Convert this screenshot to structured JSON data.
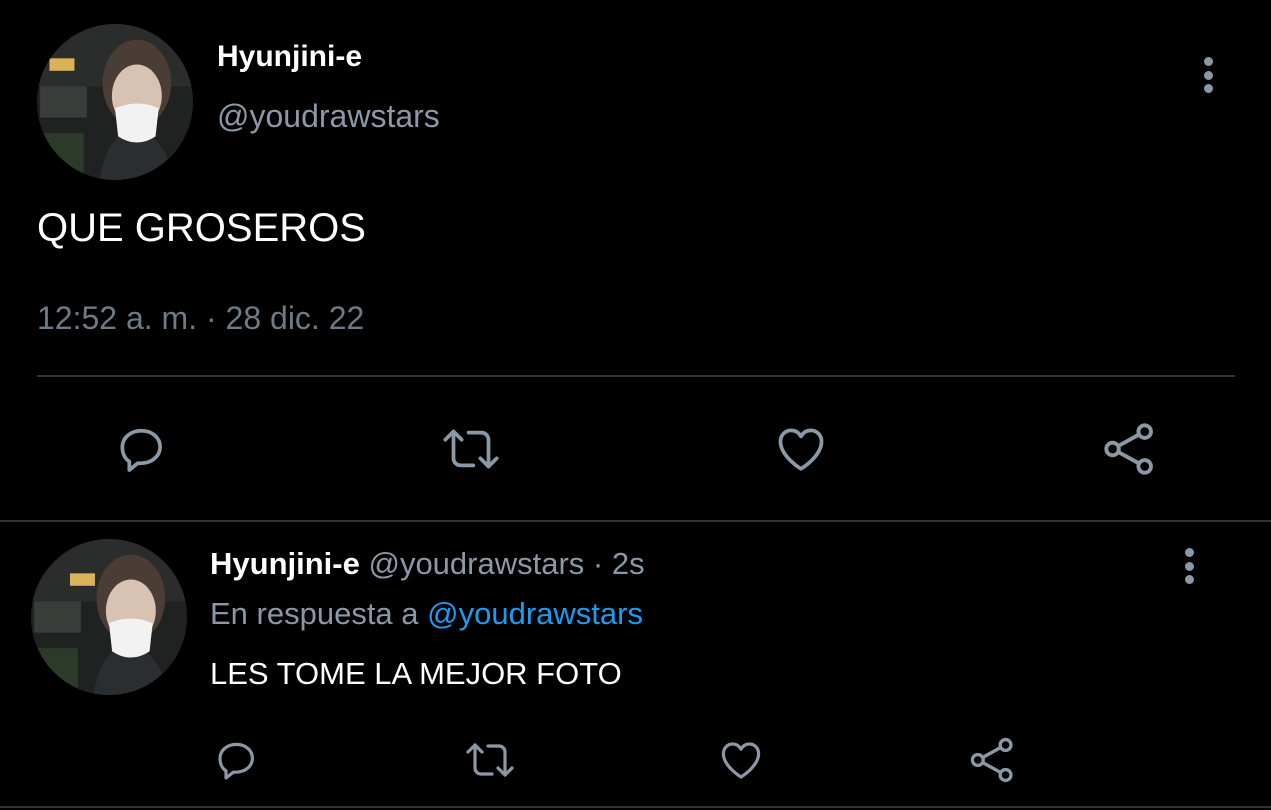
{
  "main_tweet": {
    "display_name": "Hyunjini-e",
    "handle": "@youdrawstars",
    "text": "QUE GROSEROS",
    "time": "12:52 a. m.",
    "separator": " · ",
    "date": "28 dic. 22",
    "actions": {
      "reply_icon": "reply-icon",
      "retweet_icon": "retweet-icon",
      "like_icon": "like-icon",
      "share_icon": "share-icon"
    }
  },
  "reply_tweet": {
    "display_name": "Hyunjini-e",
    "handle": "@youdrawstars",
    "separator": " · ",
    "age": "2s",
    "in_reply_to_prefix": "En respuesta a ",
    "in_reply_to_handle": "@youdrawstars",
    "text": "LES TOME LA MEJOR FOTO"
  },
  "colors": {
    "background": "#000000",
    "text_primary": "#ffffff",
    "text_secondary": "#8b98a5",
    "link": "#1d9bf0",
    "divider": "#2f3336"
  }
}
